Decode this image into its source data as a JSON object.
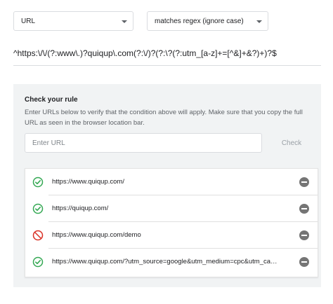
{
  "filter": {
    "field_value": "URL",
    "operator_value": "matches regex (ignore case)",
    "regex": "^https:\\/\\/(?:www\\.)?quiqup\\.com(?:\\/)?(?:\\?(?:utm_[a-z]+=[^&]+&?)+)?$"
  },
  "check_rule": {
    "title": "Check your rule",
    "description": "Enter URLs below to verify that the condition above will apply. Make sure that you copy the full URL as seen in the browser location bar.",
    "input_placeholder": "Enter URL",
    "check_label": "Check"
  },
  "results": [
    {
      "url": "https://www.quiqup.com/",
      "status": "match",
      "status_icon": "check-circle-icon"
    },
    {
      "url": "https://quiqup.com/",
      "status": "match",
      "status_icon": "check-circle-icon"
    },
    {
      "url": "https://www.quiqup.com/demo",
      "status": "no-match",
      "status_icon": "blocked-icon"
    },
    {
      "url": "https://www.quiqup.com/?utm_source=google&utm_medium=cpc&utm_campaign=brand",
      "status": "match",
      "status_icon": "check-circle-icon"
    }
  ],
  "colors": {
    "match": "#34a853",
    "no_match": "#d93025",
    "remove": "#757575",
    "panel_bg": "#f1f3f4"
  }
}
